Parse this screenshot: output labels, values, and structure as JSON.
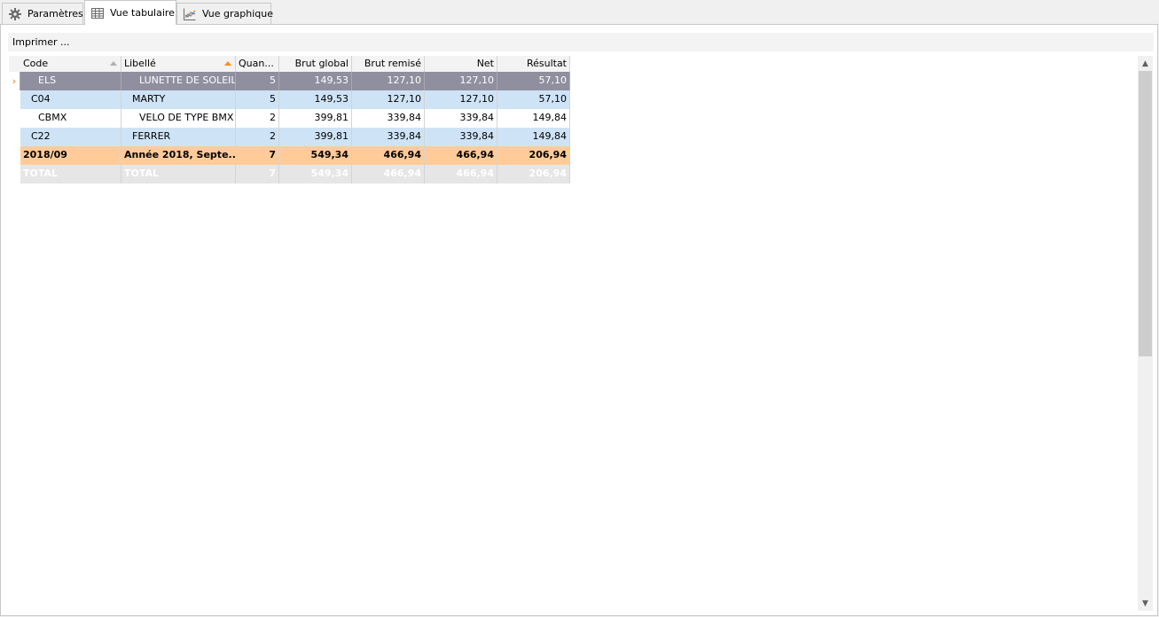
{
  "tabs": [
    {
      "label": "Paramètres",
      "icon": "gear-icon",
      "active": false
    },
    {
      "label": "Vue tabulaire",
      "icon": "table-icon",
      "active": true
    },
    {
      "label": "Vue graphique",
      "icon": "chart-icon",
      "active": false
    }
  ],
  "toolbar": {
    "print_label": "Imprimer ..."
  },
  "table": {
    "columns": [
      "Code",
      "Libellé",
      "Quan...",
      "Brut global",
      "Brut remisé",
      "Net",
      "Résultat"
    ],
    "sort": {
      "Code": "ascending-inactive",
      "Libellé": "ascending-active"
    },
    "rows": [
      {
        "code": "ELS",
        "libelle": "LUNETTE DE SOLEIL",
        "qty": "5",
        "brut_global": "149,53",
        "brut_remise": "127,10",
        "net": "127,10",
        "resultat": "57,10",
        "selected": true
      },
      {
        "code": "C04",
        "libelle": "MARTY",
        "qty": "5",
        "brut_global": "149,53",
        "brut_remise": "127,10",
        "net": "127,10",
        "resultat": "57,10"
      },
      {
        "code": "CBMX",
        "libelle": "VELO DE TYPE BMX",
        "qty": "2",
        "brut_global": "399,81",
        "brut_remise": "339,84",
        "net": "339,84",
        "resultat": "149,84"
      },
      {
        "code": "C22",
        "libelle": "FERRER",
        "qty": "2",
        "brut_global": "399,81",
        "brut_remise": "339,84",
        "net": "339,84",
        "resultat": "149,84"
      },
      {
        "code": "2018/09",
        "libelle": "Année 2018, Septe...",
        "qty": "7",
        "brut_global": "549,34",
        "brut_remise": "466,94",
        "net": "466,94",
        "resultat": "206,94"
      },
      {
        "code": "TOTAL",
        "libelle": "TOTAL",
        "qty": "7",
        "brut_global": "549,34",
        "brut_remise": "466,94",
        "net": "466,94",
        "resultat": "206,94"
      }
    ]
  },
  "colors": {
    "selected_row": "#8f8f9f",
    "group_row": "#cfe3f7",
    "subtotal_row": "#ffcc99",
    "total_row": "#e6e6e6",
    "sort_active": "#ff8c1a"
  }
}
